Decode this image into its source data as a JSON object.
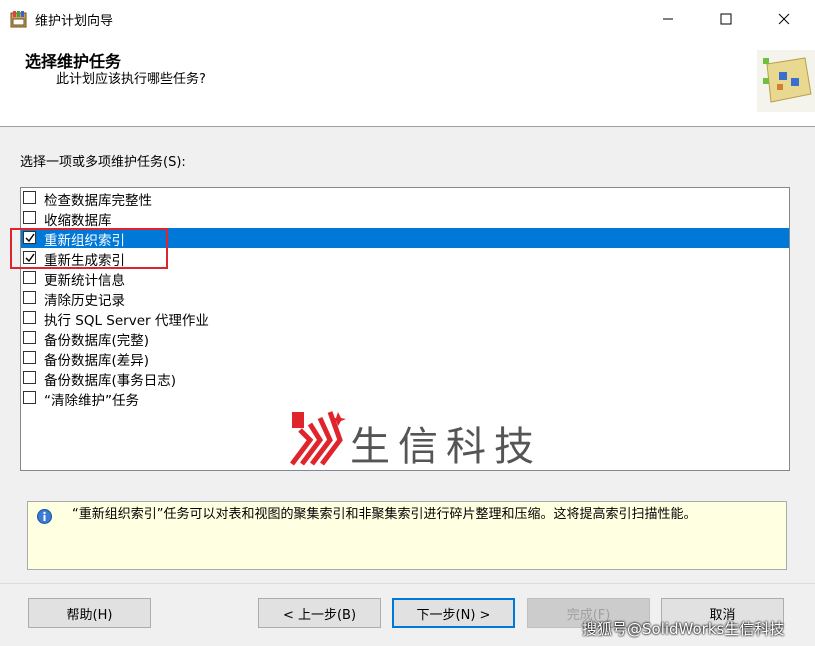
{
  "window": {
    "title": "维护计划向导",
    "minimize_glyph": "—",
    "maximize_glyph": "☐",
    "close_glyph": "✕"
  },
  "header": {
    "title": "选择维护任务",
    "subtitle": "此计划应该执行哪些任务?"
  },
  "select_label": "选择一项或多项维护任务(S):",
  "tasks": [
    {
      "label": "检查数据库完整性",
      "checked": false,
      "selected": false
    },
    {
      "label": "收缩数据库",
      "checked": false,
      "selected": false
    },
    {
      "label": "重新组织索引",
      "checked": true,
      "selected": true
    },
    {
      "label": "重新生成索引",
      "checked": true,
      "selected": false
    },
    {
      "label": "更新统计信息",
      "checked": false,
      "selected": false
    },
    {
      "label": "清除历史记录",
      "checked": false,
      "selected": false
    },
    {
      "label": "执行 SQL Server 代理作业",
      "checked": false,
      "selected": false
    },
    {
      "label": "备份数据库(完整)",
      "checked": false,
      "selected": false
    },
    {
      "label": "备份数据库(差异)",
      "checked": false,
      "selected": false
    },
    {
      "label": "备份数据库(事务日志)",
      "checked": false,
      "selected": false
    },
    {
      "label": "“清除维护”任务",
      "checked": false,
      "selected": false
    }
  ],
  "watermark": {
    "text": "生信科技"
  },
  "description": "“重新组织索引”任务可以对表和视图的聚集索引和非聚集索引进行碎片整理和压缩。这将提高索引扫描性能。",
  "buttons": {
    "help": "帮助(H)",
    "back": "< 上一步(B)",
    "next": "下一步(N) >",
    "finish": "完成(F)",
    "cancel": "取消"
  },
  "footer_watermark": "搜狐号@SolidWorks生信科技",
  "colors": {
    "selection": "#0078d7",
    "highlight_border": "#e0242b",
    "tooltip_bg": "#ffffe1"
  }
}
